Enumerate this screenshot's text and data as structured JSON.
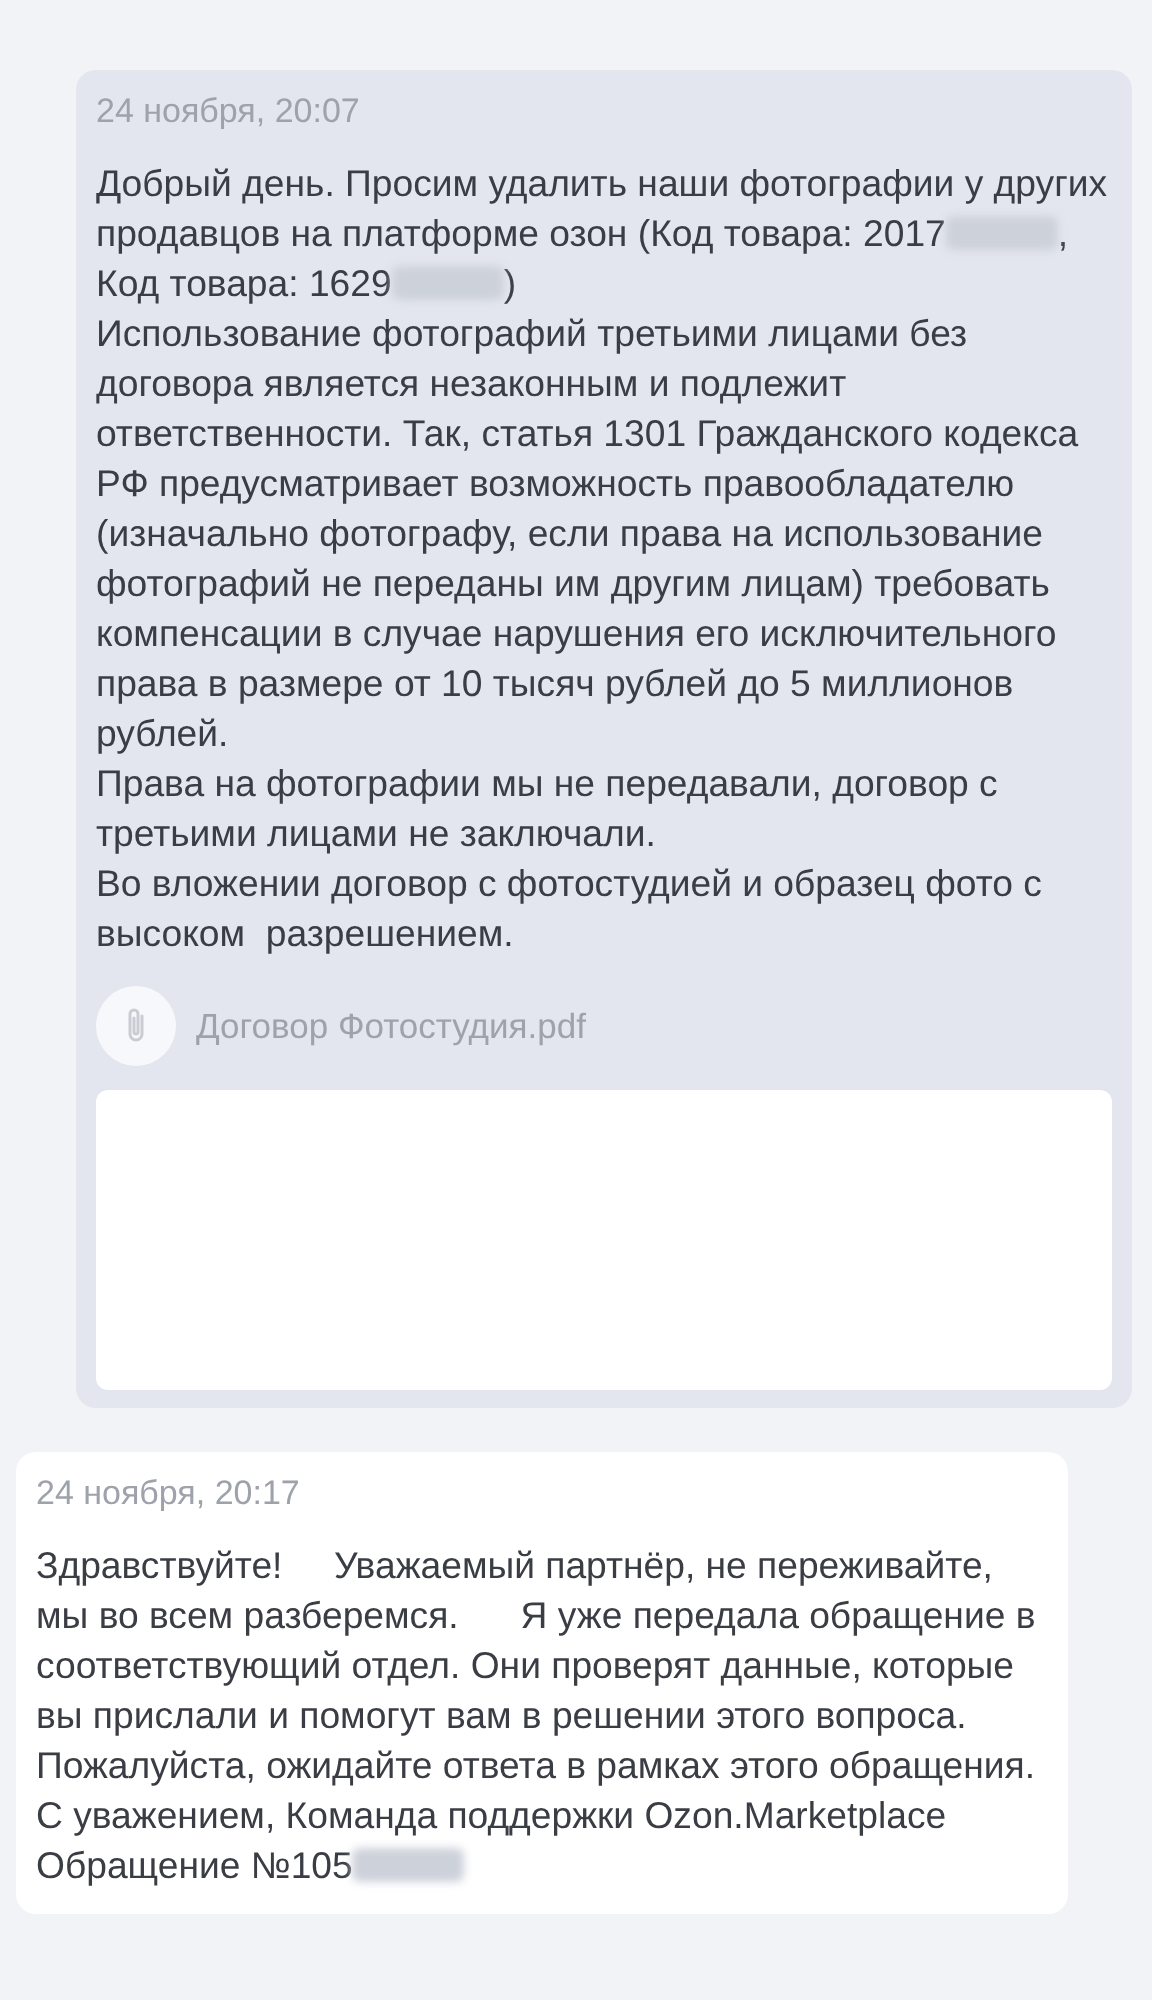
{
  "messages": [
    {
      "kind": "outgoing",
      "time": "24 ноября, 20:07",
      "paragraphs": [
        [
          {
            "kind": "text",
            "text": "Добрый день. Просим удалить наши фотографии у других продавцов на платформе озон (Код товара: 2017"
          },
          {
            "kind": "redacted"
          },
          {
            "kind": "text",
            "text": ", Код товара: 1629"
          },
          {
            "kind": "redacted"
          },
          {
            "kind": "text",
            "text": ")"
          }
        ],
        [
          {
            "kind": "text",
            "text": "Использование фотографий третьими лицами без договора является незаконным и подлежит ответственности. Так, статья 1301 Гражданского кодекса РФ предусматривает возможность правообладателю (изначально фотографу, если права на использование фотографий не переданы им другим лицам) требовать компенсации в случае нарушения его исключительного права в размере от 10 тысяч рублей до 5 миллионов рублей."
          }
        ],
        [
          {
            "kind": "text",
            "text": "Права на фотографии мы не передавали, договор с третьими лицами не заключали."
          }
        ],
        [
          {
            "kind": "text",
            "text": "Во вложении договор с фотостудией и образец фото с высоком  разрешением."
          }
        ]
      ],
      "attachments": [
        {
          "kind": "file",
          "name": "Договор Фотостудия.pdf"
        },
        {
          "kind": "preview"
        }
      ]
    },
    {
      "kind": "incoming",
      "time": "24 ноября, 20:17",
      "paragraphs": [
        [
          {
            "kind": "text",
            "text": "Здравствуйте!     Уважаемый партнёр, не переживайте, мы во всем разберемся.      Я уже передала обращение в соответствующий отдел. Они проверят данные, которые вы прислали и помогут вам в решении этого вопроса. Пожалуйста, ожидайте ответа в рамках этого обращения.         С уважением, Команда поддержки Ozon.Marketplace  Обращение №105"
          },
          {
            "kind": "redacted"
          }
        ]
      ]
    }
  ]
}
